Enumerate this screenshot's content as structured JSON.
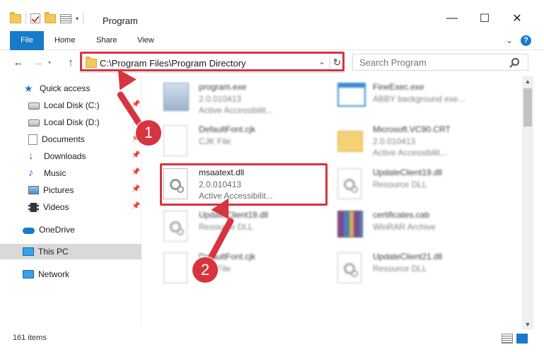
{
  "window": {
    "title": "Program",
    "minimize": "—",
    "maximize": "☐",
    "close": "✕"
  },
  "ribbon": {
    "tabs": [
      "File",
      "Home",
      "Share",
      "View"
    ],
    "expand_caret": "⌄",
    "help": "?"
  },
  "nav": {
    "back": "←",
    "forward": "→",
    "up": "↑",
    "address": "C:\\Program Files\\Program Directory",
    "address_dropdown": "⌄",
    "refresh": "↻",
    "search_placeholder": "Search Program"
  },
  "sidebar": {
    "items": [
      {
        "label": "Quick access",
        "icon": "star-icon",
        "pinned": false
      },
      {
        "label": "Local Disk (C:)",
        "icon": "disk-icon",
        "pinned": true
      },
      {
        "label": "Local Disk (D:)",
        "icon": "disk-icon",
        "pinned": true
      },
      {
        "label": "Documents",
        "icon": "documents-icon",
        "pinned": true
      },
      {
        "label": "Downloads",
        "icon": "download-icon",
        "pinned": true
      },
      {
        "label": "Music",
        "icon": "music-icon",
        "pinned": true
      },
      {
        "label": "Pictures",
        "icon": "pictures-icon",
        "pinned": true
      },
      {
        "label": "Videos",
        "icon": "videos-icon",
        "pinned": true
      },
      {
        "label": "OneDrive",
        "icon": "cloud-icon",
        "pinned": false
      },
      {
        "label": "This PC",
        "icon": "computer-icon",
        "pinned": false,
        "selected": true
      },
      {
        "label": "Network",
        "icon": "network-icon",
        "pinned": false
      }
    ]
  },
  "files": [
    {
      "name": "program.exe",
      "line1": "2.0.010413",
      "line2": "Active Accessibilit...",
      "icon": "exe-icon",
      "blurred": true
    },
    {
      "name": "FineExec.exe",
      "line1": "ABBY background exe...",
      "line2": "",
      "icon": "window-icon",
      "blurred": true
    },
    {
      "name": "DefaultFont.cjk",
      "line1": "CJK File",
      "line2": "",
      "icon": "document-icon",
      "blurred": true
    },
    {
      "name": "Microsoft.VC90.CRT",
      "line1": "2.0.010413",
      "line2": "Active Accessibilit...",
      "icon": "folder-icon",
      "blurred": true
    },
    {
      "name": "msaatext.dll",
      "line1": "2.0.010413",
      "line2": "Active Accessibilit...",
      "icon": "dll-gear-icon",
      "blurred": false
    },
    {
      "name": "UpdateClient19.dll",
      "line1": "Resource DLL",
      "line2": "",
      "icon": "dll-gear-icon",
      "blurred": true
    },
    {
      "name": "UpdateClient19.dll",
      "line1": "Resource DLL",
      "line2": "",
      "icon": "dll-gear-icon",
      "blurred": true
    },
    {
      "name": "certificates.cab",
      "line1": "WinRAR Archive",
      "line2": "",
      "icon": "archive-icon",
      "blurred": true
    },
    {
      "name": "DefaultFont.cjk",
      "line1": "CJK File",
      "line2": "",
      "icon": "document-icon",
      "blurred": true
    },
    {
      "name": "UpdateClient21.dll",
      "line1": "Resource DLL",
      "line2": "",
      "icon": "dll-gear-icon",
      "blurred": true
    }
  ],
  "scrollbar": {
    "up": "▲",
    "down": "▼"
  },
  "status": {
    "item_count": "161 items"
  },
  "annotations": {
    "step1": "1",
    "step2": "2",
    "highlight_color": "#d6343f"
  },
  "colors": {
    "accent": "#1979ca",
    "selection": "#d9d9d9"
  }
}
